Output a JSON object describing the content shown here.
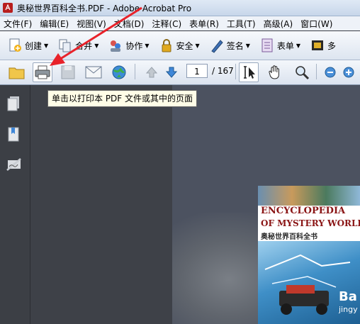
{
  "window": {
    "title": "奥秘世界百科全书.PDF - Adobe Acrobat Pro"
  },
  "menubar": {
    "items": [
      "文件(F)",
      "编辑(E)",
      "视图(V)",
      "文档(D)",
      "注释(C)",
      "表单(R)",
      "工具(T)",
      "高级(A)",
      "窗口(W)"
    ]
  },
  "tasks": {
    "create": "创建",
    "combine": "合并",
    "collaborate": "协作",
    "secure": "安全",
    "sign": "签名",
    "forms": "表单",
    "multimedia": "多"
  },
  "navigation": {
    "current_page": "1",
    "total_pages": "/ 167"
  },
  "tooltip": {
    "print": "单击以打印本 PDF 文件或其中的页面"
  },
  "cover": {
    "title_line1": "ENCYCLOPEDIA",
    "title_line2": "OF MYSTERY WORLD",
    "chinese_title": "奥秘世界百科全书"
  },
  "watermark": {
    "main": "Ba",
    "sub": "jingy"
  },
  "colors": {
    "annotation_arrow": "#e8222a",
    "title_red": "#8a1515"
  }
}
